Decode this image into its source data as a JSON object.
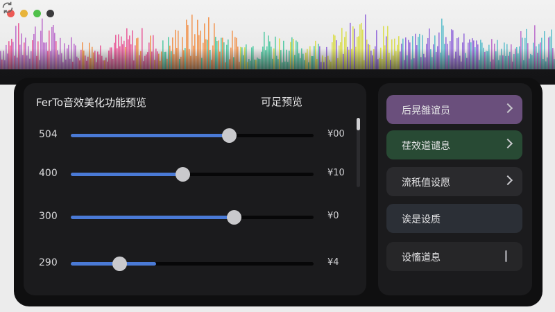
{
  "window": {
    "traffic_lights": [
      "close",
      "minimize",
      "zoom",
      "inactive"
    ],
    "sync_icon": "sync-icon"
  },
  "waveform": {
    "palette": [
      "#b65fc8",
      "#e84a8f",
      "#f28a3c",
      "#3fc59a",
      "#d8dc3c",
      "#8a5ad8",
      "#4bb8c8"
    ]
  },
  "left_panel": {
    "title": "FerTo音效美化功能预览",
    "preview_label": "可足预览",
    "sliders": [
      {
        "label": "504",
        "fraction": 0.65,
        "value_text": "¥00"
      },
      {
        "label": "400",
        "fraction": 0.46,
        "value_text": "¥10"
      },
      {
        "label": "300",
        "fraction": 0.67,
        "value_text": "¥0"
      },
      {
        "label": "290",
        "fraction": 0.2,
        "fill_fraction": 0.35,
        "value_text": "¥4"
      }
    ]
  },
  "right_panel": {
    "items": [
      {
        "label": "后晃雒谊员",
        "color": "#6a4f7c",
        "icon": "chevron-right-icon"
      },
      {
        "label": "荏效道谴息",
        "color": "#284a34",
        "icon": "chevron-right-icon"
      },
      {
        "label": "流秖值设愿",
        "color": "#2a2a2d",
        "icon": "chevron-right-icon"
      },
      {
        "label": "诶是设质",
        "color": "#2b2f36",
        "icon": ""
      },
      {
        "label": "设慉道息",
        "color": "#262628",
        "icon": "info-icon"
      }
    ]
  }
}
